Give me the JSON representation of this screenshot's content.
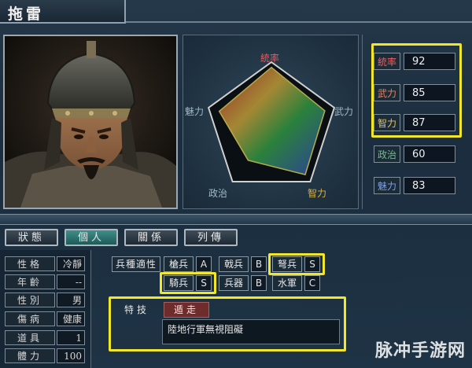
{
  "character": {
    "name": "拖雷"
  },
  "radar": {
    "labels": {
      "command": "統率",
      "war": "武力",
      "intelligence": "智力",
      "politics": "政治",
      "charm": "魅力"
    },
    "values": {
      "command": 92,
      "war": 85,
      "intelligence": 87,
      "politics": 60,
      "charm": 83
    },
    "max": 100
  },
  "stats": [
    {
      "name": "統率",
      "value": "92"
    },
    {
      "name": "武力",
      "value": "85"
    },
    {
      "name": "智力",
      "value": "87"
    },
    {
      "name": "政治",
      "value": "60"
    },
    {
      "name": "魅力",
      "value": "83"
    }
  ],
  "tabs": [
    {
      "label": "狀態",
      "active": false
    },
    {
      "label": "個人",
      "active": true
    },
    {
      "label": "關係",
      "active": false
    },
    {
      "label": "列傳",
      "active": false
    }
  ],
  "info": [
    {
      "label": "性格",
      "value": "冷靜"
    },
    {
      "label": "年齡",
      "value": "--"
    },
    {
      "label": "性別",
      "value": "男"
    },
    {
      "label": "傷病",
      "value": "健康"
    },
    {
      "label": "道具",
      "value": "1"
    },
    {
      "label": "體力",
      "value": "100"
    }
  ],
  "aptitude": {
    "header": "兵種適性",
    "units": [
      {
        "name": "槍兵",
        "grade": "A"
      },
      {
        "name": "戟兵",
        "grade": "B"
      },
      {
        "name": "弩兵",
        "grade": "S"
      },
      {
        "name": "騎兵",
        "grade": "S"
      },
      {
        "name": "兵器",
        "grade": "B"
      },
      {
        "name": "水軍",
        "grade": "C"
      }
    ]
  },
  "skill": {
    "label": "特技",
    "name": "遁走",
    "description": "陸地行軍無視阻礙"
  },
  "watermark": "脉冲手游网",
  "colors": {
    "highlight": "#f2e628",
    "active_tab": "#2f7370",
    "skill_badge": "#6e2c2c"
  }
}
